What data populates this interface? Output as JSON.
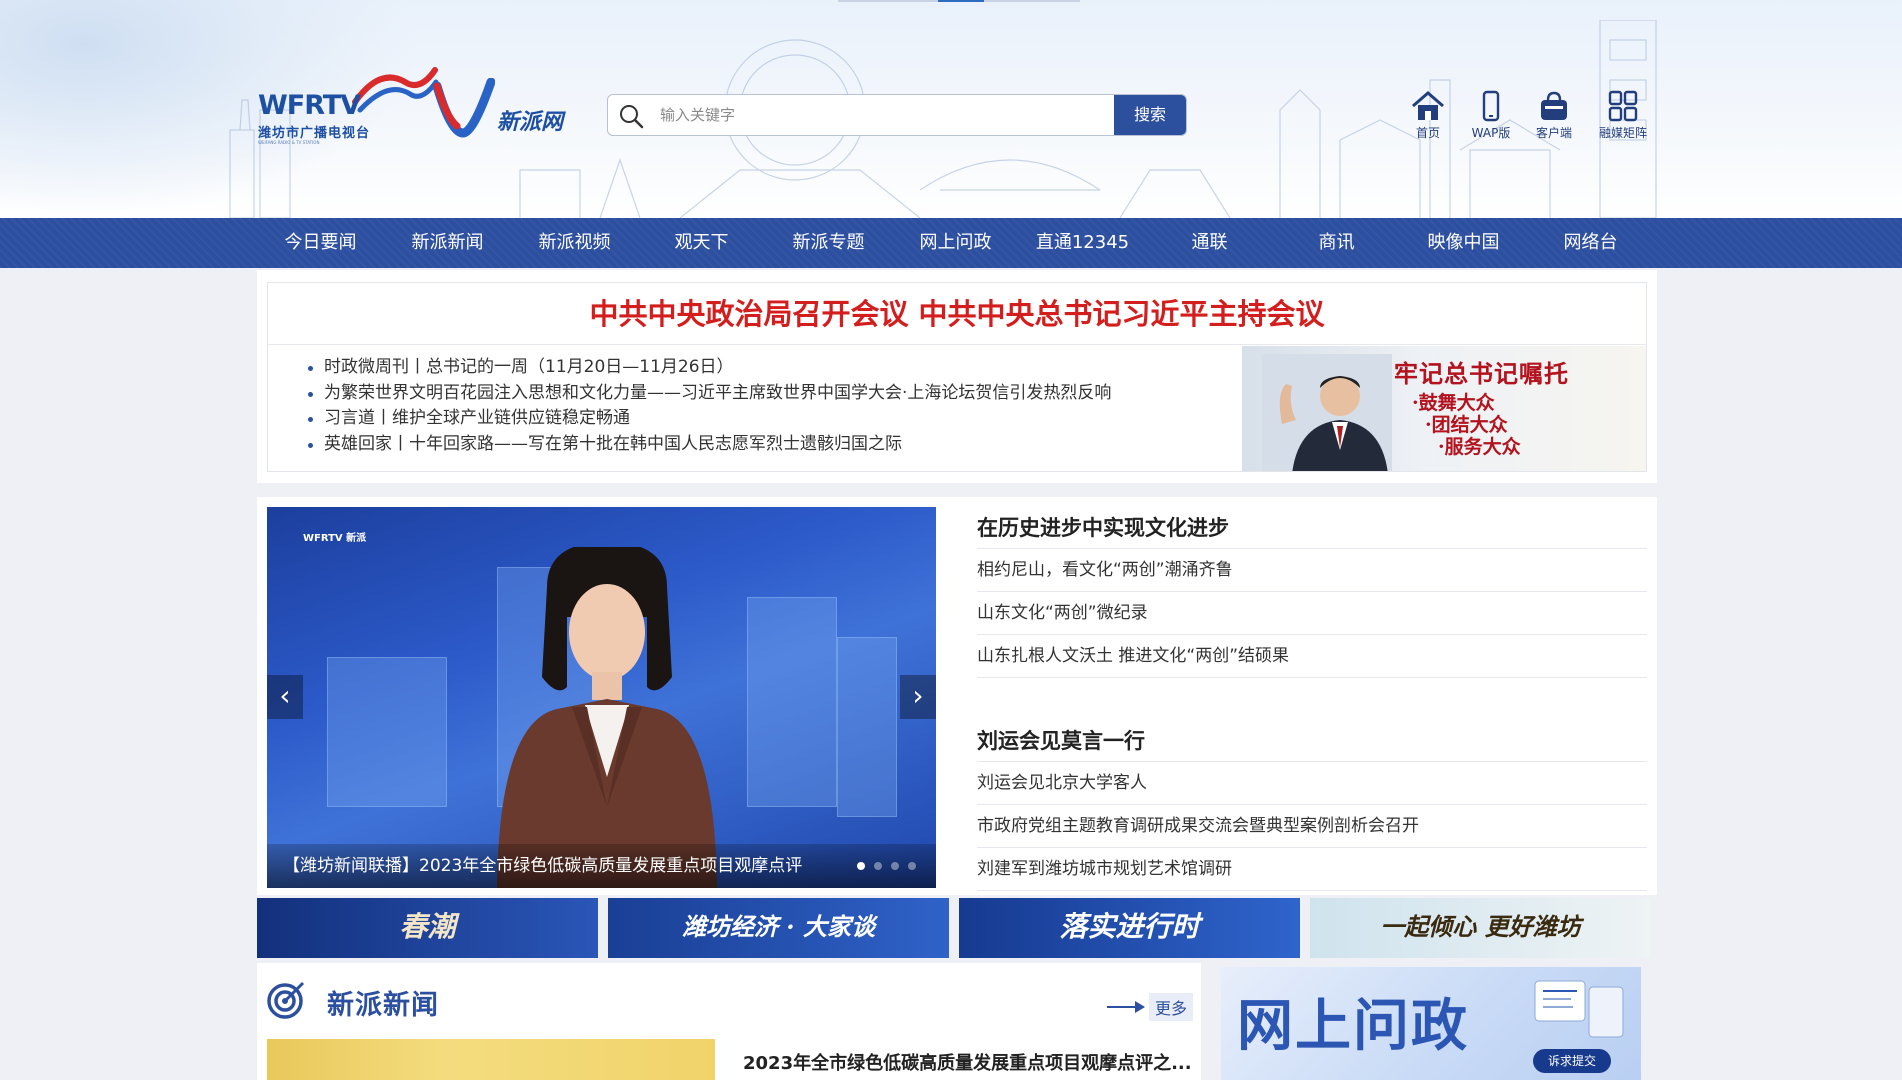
{
  "header": {
    "logo_wfrtv_text": "WFRTV",
    "logo_wfrtv_cn": "潍坊市广播电视台",
    "logo_wfrtv_sub": "WEIFANG RADIO & TV STATION",
    "logo_xinpai_text": "新派网",
    "search": {
      "placeholder": "输入关键字",
      "button_label": "搜索"
    },
    "quick_links": [
      {
        "label": "首页",
        "icon": "home-icon"
      },
      {
        "label": "WAP版",
        "icon": "phone-icon"
      },
      {
        "label": "客户端",
        "icon": "bag-icon"
      },
      {
        "label": "融媒矩阵",
        "icon": "grid-icon"
      }
    ]
  },
  "nav": {
    "items": [
      "今日要闻",
      "新派新闻",
      "新派视频",
      "观天下",
      "新派专题",
      "网上问政",
      "直通12345",
      "通联",
      "商讯",
      "映像中国",
      "网络台"
    ]
  },
  "headline": {
    "title": "中共中央政治局召开会议 中共中央总书记习近平主持会议",
    "items": [
      "时政微周刊丨总书记的一周（11月20日—11月26日）",
      "为繁荣世界文明百花园注入思想和文化力量——习近平主席致世界中国学大会·上海论坛贺信引发热烈反响",
      "习言道丨维护全球产业链供应链稳定畅通",
      "英雄回家丨十年回家路——写在第十批在韩中国人民志愿军烈士遗骸归国之际"
    ],
    "promo": {
      "title": "牢记总书记嘱托",
      "lines": [
        "·鼓舞大众",
        "·团结大众",
        "·服务大众"
      ]
    }
  },
  "slider": {
    "logo_text": "WFRTV  新派",
    "caption": "【潍坊新闻联播】2023年全市绿色低碳高质量发展重点项目观摩点评",
    "prev_label": "‹",
    "next_label": "›",
    "dot_count": 4,
    "active_dot": 0
  },
  "topics": [
    {
      "title": "在历史进步中实现文化进步",
      "items": [
        "相约尼山，看文化“两创”潮涌齐鲁",
        "山东文化“两创”微纪录",
        "山东扎根人文沃土 推进文化“两创”结硕果"
      ]
    },
    {
      "title": "刘运会见莫言一行",
      "items": [
        "刘运会见北京大学客人",
        "市政府党组主题教育调研成果交流会暨典型案例剖析会召开",
        "刘建军到潍坊城市规划艺术馆调研"
      ]
    }
  ],
  "banners": [
    {
      "text": "春潮",
      "bg": "#1d3f9a",
      "fg": "#f3e6c8"
    },
    {
      "text": "潍坊经济 · 大家谈",
      "bg": "#1e4cae",
      "fg": "#ffffff"
    },
    {
      "text": "落实进行时",
      "bg": "#1f4fb8",
      "fg": "#ffffff"
    },
    {
      "text": "一起倾心 更好潍坊",
      "bg": "#dbe9f2",
      "fg": "#3a2a10"
    }
  ],
  "news_section": {
    "title": "新派新闻",
    "more_label": "更多",
    "first_headline": "2023年全市绿色低碳高质量发展重点项目观摩点评之..."
  },
  "wlwz_banner": {
    "title": "网上问政",
    "button_label": "诉求提交"
  },
  "colors": {
    "nav_bg": "#2d4fa0",
    "headline_red": "#d41e1e",
    "brand_blue": "#1d4fa3"
  }
}
